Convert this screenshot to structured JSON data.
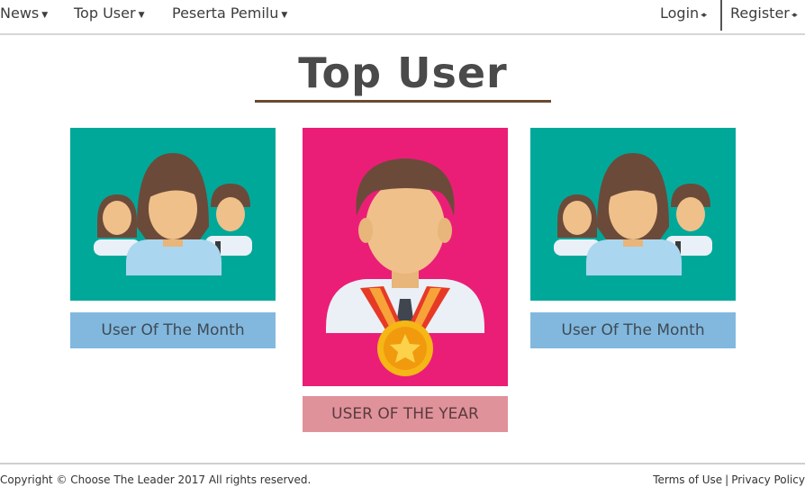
{
  "nav": {
    "news": "News",
    "top_user": "Top User",
    "peserta": "Peserta Pemilu",
    "login": "Login",
    "register": "Register"
  },
  "title": "Top User",
  "cards": [
    {
      "label": "User Of The Month",
      "icon": "user-group-icon"
    },
    {
      "label": "USER OF THE YEAR",
      "icon": "user-medal-icon"
    },
    {
      "label": "User Of The Month",
      "icon": "user-group-icon"
    }
  ],
  "footer": {
    "copyright": "Copyright © Choose The Leader 2017 All rights reserved.",
    "terms": "Terms of Use",
    "separator": "|",
    "privacy": "Privacy Policy"
  },
  "colors": {
    "teal": "#00a89a",
    "pink": "#eb1e77",
    "label_blue": "#82b8de",
    "label_rose": "#e0929a",
    "underline": "#6a4a30"
  }
}
